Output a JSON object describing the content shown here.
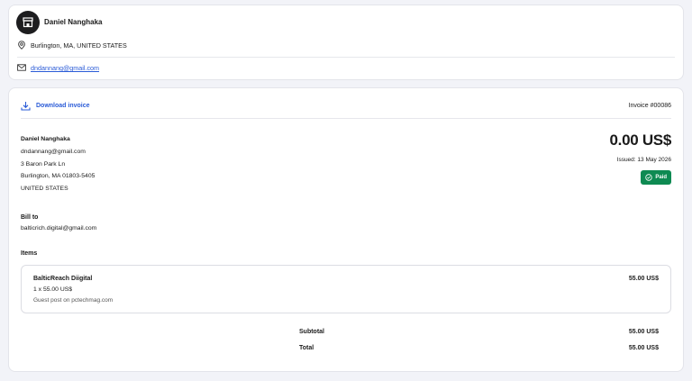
{
  "seller": {
    "name": "Daniel Nanghaka",
    "location": "Burlington, MA, UNITED STATES",
    "email": "dndannang@gmail.com"
  },
  "invoice": {
    "download_label": "Download invoice",
    "number": "Invoice #00086",
    "amount": "0.00 US$",
    "issued": "Issued: 13 May 2026",
    "status": "Paid",
    "status_color": "#0e8a52",
    "accent_color": "#2a5bd7",
    "from": {
      "name": "Daniel Nanghaka",
      "email": "dndannang@gmail.com",
      "street": "3 Baron Park Ln",
      "city": "Burlington, MA 01803-5405",
      "country": "UNITED STATES"
    },
    "bill_to": {
      "label": "Bill to",
      "email": "balticrich.digital@gmail.com"
    },
    "items_label": "Items",
    "items": [
      {
        "name": "BalticReach Diigital",
        "qty": "1 x 55.00 US$",
        "description": "Guest post on pctechmag.com",
        "price": "55.00 US$"
      }
    ],
    "subtotal_label": "Subtotal",
    "subtotal": "55.00 US$",
    "total_label": "Total",
    "total": "55.00 US$"
  },
  "icons": {
    "avatar": "storefront-icon",
    "location": "map-pin-icon",
    "email": "envelope-icon",
    "download": "download-icon",
    "paid": "check-circle-icon"
  }
}
